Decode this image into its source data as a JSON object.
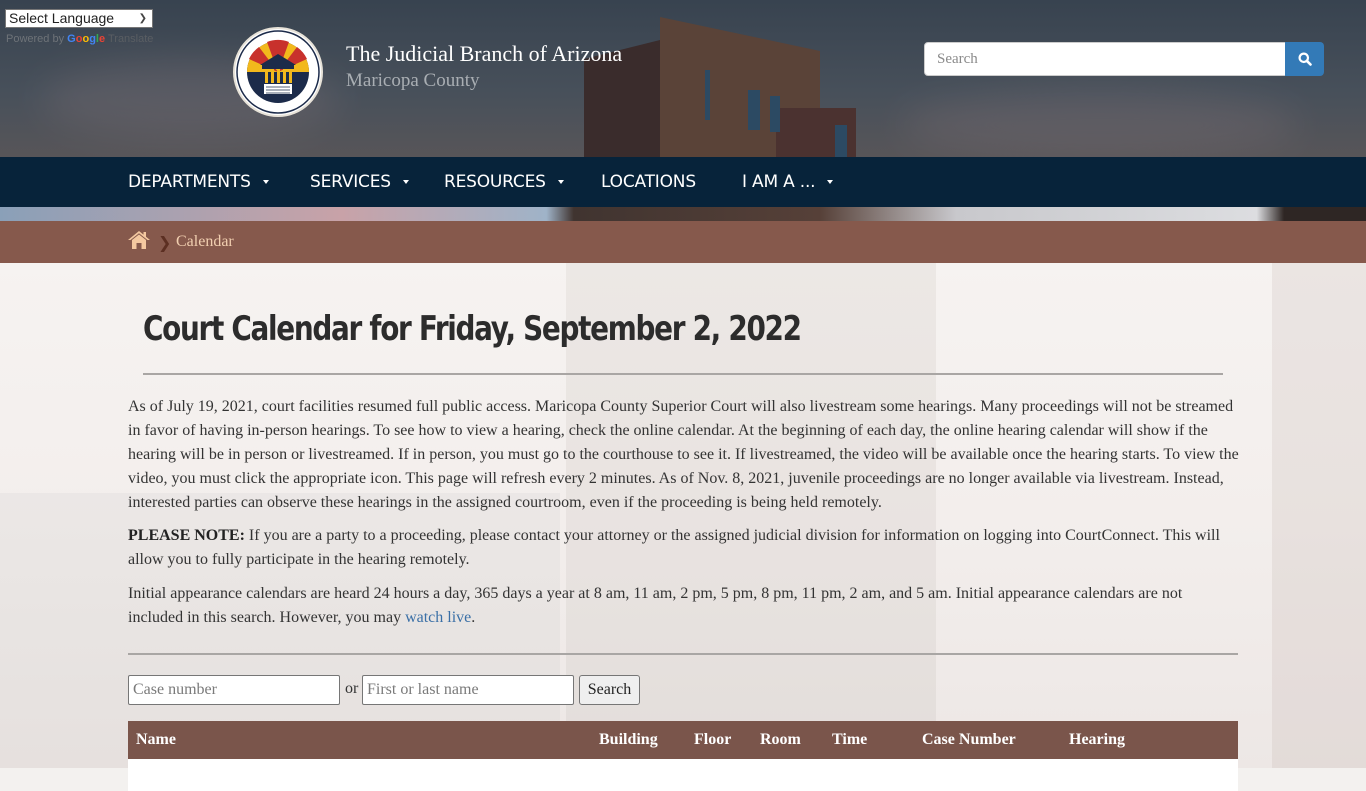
{
  "language": {
    "select_label": "Select Language",
    "powered_by": "Powered by",
    "google": [
      "G",
      "o",
      "o",
      "g",
      "l",
      "e"
    ],
    "translate": "Translate"
  },
  "site": {
    "title": "The Judicial Branch of Arizona",
    "subtitle": "Maricopa County",
    "seal_alt": "The Judicial Branch of Arizona – Maricopa County seal"
  },
  "search": {
    "placeholder": "Search",
    "button_icon": "search-icon",
    "accent": "#337ab7"
  },
  "nav": {
    "items": [
      {
        "label": "DEPARTMENTS",
        "has_dropdown": true
      },
      {
        "label": "SERVICES",
        "has_dropdown": true
      },
      {
        "label": "RESOURCES",
        "has_dropdown": true
      },
      {
        "label": "LOCATIONS",
        "has_dropdown": false
      },
      {
        "label": "I AM A ...",
        "has_dropdown": true
      }
    ],
    "background": "#07233a"
  },
  "breadcrumb": {
    "home_icon": "home-icon",
    "separator_icon": "chevron-right-icon",
    "current": "Calendar",
    "background": "#86594c"
  },
  "main": {
    "title": "Court Calendar for Friday, September 2, 2022",
    "intro": "As of July 19, 2021, court facilities resumed full public access. Maricopa County Superior Court will also livestream some hearings. Many proceedings will not be streamed in favor of having in-person hearings. To see how to view a hearing, check the online calendar. At the beginning of each day, the online hearing calendar will show if the hearing will be in person or livestreamed. If in person, you must go to the courthouse to see it. If livestreamed, the video will be available once the hearing starts. To view the video, you must click the appropriate icon. This page will refresh every 2 minutes. As of Nov. 8, 2021, juvenile proceedings are no longer available via livestream. Instead, interested parties can observe these hearings in the assigned courtroom, even if the proceeding is being held remotely.",
    "note_label": "PLEASE NOTE:",
    "note_text": " If you are a party to a proceeding, please contact your attorney or the assigned judicial division for information on logging into CourtConnect. This will allow you to fully participate in the hearing remotely.",
    "initial_text": "Initial appearance calendars are heard 24 hours a day, 365 days a year at 8 am, 11 am, 2 pm, 5 pm, 8 pm, 11 pm, 2 am, and 5 am. Initial appearance calendars are not included in this search. However, you may ",
    "watch_live_link": "watch live",
    "initial_end": "."
  },
  "search_form": {
    "case_placeholder": "Case number",
    "or_label": "or",
    "name_placeholder": "First or last name",
    "button_label": "Search"
  },
  "table": {
    "columns": [
      "Name",
      "Building",
      "Floor",
      "Room",
      "Time",
      "Case Number",
      "Hearing"
    ],
    "header_background": "#7a554b",
    "rows": []
  }
}
